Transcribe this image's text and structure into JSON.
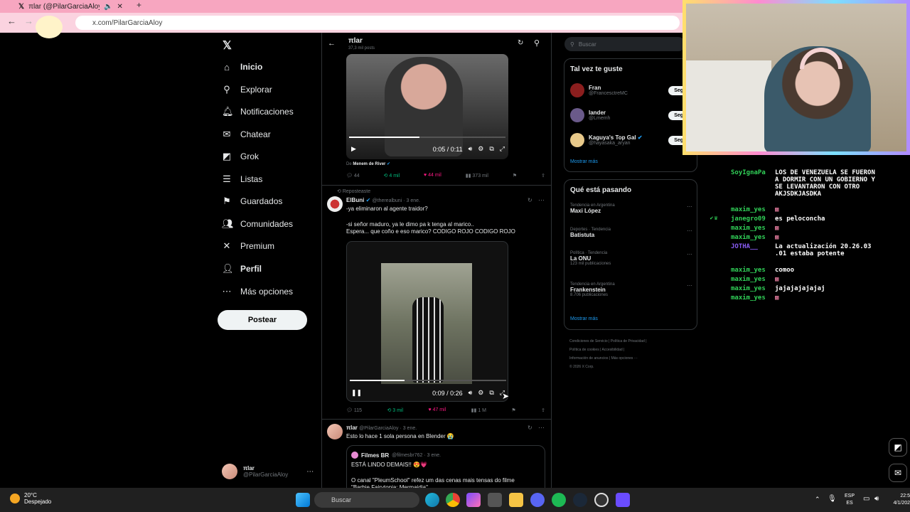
{
  "browser": {
    "tab_title": "πlar (@PilarGarciaAloy) / X",
    "url": "x.com/PilarGarciaAloy"
  },
  "sidebar": {
    "items": [
      {
        "label": "Inicio",
        "icon": "home-icon"
      },
      {
        "label": "Explorar",
        "icon": "search-icon"
      },
      {
        "label": "Notificaciones",
        "icon": "bell-icon"
      },
      {
        "label": "Chatear",
        "icon": "mail-icon"
      },
      {
        "label": "Grok",
        "icon": "grok-icon"
      },
      {
        "label": "Listas",
        "icon": "list-icon"
      },
      {
        "label": "Guardados",
        "icon": "bookmark-icon"
      },
      {
        "label": "Comunidades",
        "icon": "people-icon"
      },
      {
        "label": "Premium",
        "icon": "x-icon"
      },
      {
        "label": "Perfil",
        "icon": "person-icon"
      },
      {
        "label": "Más opciones",
        "icon": "more-icon"
      }
    ],
    "post_label": "Postear",
    "account_name": "πlar",
    "account_handle": "@PilarGarciaAloy"
  },
  "feed": {
    "header_name": "πlar",
    "header_posts": "37,3 mil posts",
    "post1": {
      "time": "0:05 / 0:11",
      "source_prefix": "De",
      "source": "Menem de River",
      "replies": "44",
      "reposts": "4 mil",
      "likes": "44 mil",
      "views": "373 mil"
    },
    "post2": {
      "repost_label": "Reposteaste",
      "author": "ElBuni",
      "handle": "@therealbuni · 3 ene.",
      "line1": "-ya eliminaron al agente traidor?",
      "line2": "-si señor maduro, ya le dimo pa k tenga al marico..",
      "line3": "Espera... que coño e eso marico? CODIGO ROJO CODIGO ROJO",
      "time": "0:09 / 0:26",
      "replies": "115",
      "reposts": "3 mil",
      "likes": "47 mil",
      "views": "1 M"
    },
    "post3": {
      "author": "πlar",
      "handle": "@PilarGarciaAloy · 3 ene.",
      "text": "Esto lo hace 1 sola persona en Blender 😭",
      "quote_author": "Filmes BR",
      "quote_handle": "@filmesbr762 · 3 ene.",
      "quote_line1": "ESTÁ LINDO DEMAIS!! 😍💗",
      "quote_line2": "O canal \"PleumSchool\" refez um das cenas mais tensas do filme",
      "quote_line3": "\"Barbie Fairytopia: Mermaidia\""
    }
  },
  "right": {
    "search_placeholder": "Buscar",
    "suggest_title": "Tal vez te guste",
    "suggestions": [
      {
        "name": "Fran",
        "handle": "@FrancesctreMC"
      },
      {
        "name": "lander",
        "handle": "@Lmemh"
      },
      {
        "name": "Kaguya's Top Gal",
        "handle": "@hayasaka_aryan"
      }
    ],
    "follow_label": "Seguir",
    "show_more": "Mostrar más",
    "trends_title": "Qué está pasando",
    "trends": [
      {
        "category": "Tendencia en Argentina",
        "name": "Maxi López",
        "count": ""
      },
      {
        "category": "Deportes · Tendencia",
        "name": "Batistuta",
        "count": ""
      },
      {
        "category": "Política · Tendencia",
        "name": "La ONU",
        "count": "123 mil publicaciones"
      },
      {
        "category": "Tendencia en Argentina",
        "name": "Frankenstein",
        "count": "8.706 publicaciones"
      }
    ],
    "footer": [
      "Condiciones de Servicio",
      "Política de Privacidad",
      "Política de cookies",
      "Accesibilidad",
      "Información de anuncios",
      "Más opciones ···",
      "© 2026 X Corp."
    ]
  },
  "chat": [
    {
      "user": "SoyIgnaPa",
      "msg": "LOS DE VENEZUELA SE FUERON A DORMIR CON UN GOBIERNO Y SE LEVANTARON CON OTRO AKJSDKJASDKA"
    },
    {
      "user": "maxim_yes",
      "msg": "▩"
    },
    {
      "user": "janegro09",
      "msg": "es peloconcha"
    },
    {
      "user": "maxim_yes",
      "msg": "▩"
    },
    {
      "user": "maxim_yes",
      "msg": "▩"
    },
    {
      "user": "JOTHA__",
      "msg": "La actualización 20.26.03 .01 estaba potente"
    },
    {
      "user": "maxim_yes",
      "msg": "comoo"
    },
    {
      "user": "maxim_yes",
      "msg": "▩"
    },
    {
      "user": "maxim_yes",
      "msg": "jajajajajajaj"
    },
    {
      "user": "maxim_yes",
      "msg": "▩"
    }
  ],
  "taskbar": {
    "weather_temp": "20°C",
    "weather_desc": "Despejado",
    "search_placeholder": "Buscar",
    "lang1": "ESP",
    "lang2": "ES",
    "time": "22:5",
    "date": "4/1/202"
  },
  "colors": {
    "accent": "#1d9bf0",
    "like": "#f91880",
    "repost": "#00ba7c",
    "tabbar": "#f7a6c0"
  }
}
